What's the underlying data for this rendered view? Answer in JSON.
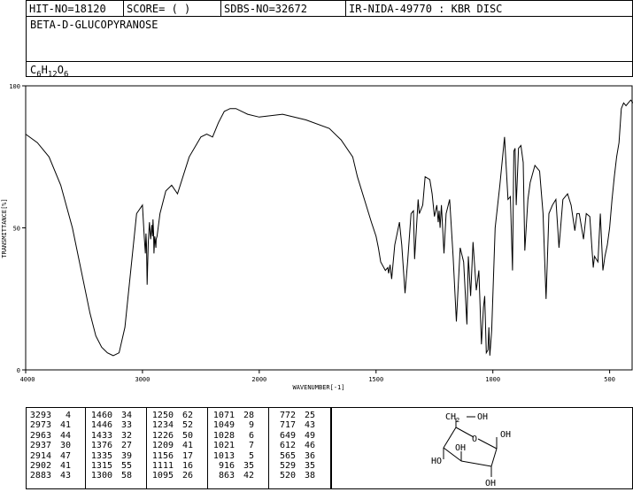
{
  "header": {
    "hit_no": "HIT-NO=18120",
    "score": "SCORE=  (   )",
    "sdbs_no": "SDBS-NO=32672",
    "ir_code": "IR-NIDA-49770 : KBR DISC",
    "compound_name": "BETA-D-GLUCOPYRANOSE",
    "formula": {
      "c": "C",
      "c_n": "6",
      "h": "H",
      "h_n": "12",
      "o": "O",
      "o_n": "6"
    }
  },
  "chart_data": {
    "type": "line",
    "xlabel": "WAVENUMBER[-1]",
    "ylabel": "TRANSMITTANCE[%]",
    "xlim": [
      4000,
      400
    ],
    "ylim": [
      0,
      100
    ],
    "x_ticks": [
      4000,
      3000,
      2000,
      1500,
      1000,
      500
    ],
    "y_ticks": [
      0,
      50,
      100
    ],
    "series": [
      {
        "x": [
          4000,
          3900,
          3800,
          3700,
          3600,
          3500,
          3450,
          3400,
          3350,
          3300,
          3250,
          3200,
          3150,
          3100,
          3050,
          3000,
          2985,
          2975,
          2970,
          2965,
          2960,
          2950,
          2940,
          2937,
          2930,
          2920,
          2914,
          2910,
          2905,
          2902,
          2895,
          2885,
          2883,
          2875,
          2850,
          2800,
          2750,
          2700,
          2600,
          2500,
          2450,
          2400,
          2350,
          2300,
          2250,
          2200,
          2150,
          2100,
          2000,
          1900,
          1800,
          1700,
          1650,
          1600,
          1580,
          1550,
          1520,
          1500,
          1490,
          1480,
          1460,
          1450,
          1446,
          1440,
          1433,
          1420,
          1400,
          1390,
          1376,
          1365,
          1350,
          1340,
          1335,
          1320,
          1315,
          1300,
          1290,
          1270,
          1260,
          1250,
          1240,
          1234,
          1230,
          1226,
          1220,
          1209,
          1200,
          1185,
          1170,
          1156,
          1140,
          1125,
          1111,
          1105,
          1095,
          1085,
          1071,
          1060,
          1049,
          1040,
          1035,
          1028,
          1021,
          1017,
          1013,
          1005,
          990,
          970,
          950,
          935,
          925,
          916,
          910,
          905,
          900,
          890,
          880,
          870,
          863,
          850,
          840,
          820,
          800,
          785,
          772,
          760,
          745,
          730,
          717,
          700,
          680,
          665,
          649,
          640,
          630,
          612,
          600,
          585,
          570,
          565,
          550,
          540,
          529,
          520,
          510,
          500,
          490,
          480,
          470,
          460,
          450,
          440,
          430,
          420,
          410,
          400
        ],
        "y": [
          83,
          80,
          75,
          65,
          50,
          30,
          20,
          12,
          8,
          6,
          5,
          6,
          15,
          35,
          55,
          58,
          47,
          41,
          48,
          44,
          30,
          45,
          52,
          50,
          46,
          51,
          47,
          53,
          48,
          41,
          47,
          43,
          46,
          47,
          55,
          63,
          65,
          62,
          75,
          82,
          83,
          82,
          87,
          91,
          92,
          92,
          91,
          90,
          89,
          90,
          88,
          85,
          81,
          75,
          68,
          60,
          52,
          47,
          43,
          38,
          35,
          36,
          34,
          37,
          32,
          44,
          52,
          44,
          27,
          38,
          55,
          56,
          39,
          60,
          55,
          58,
          68,
          67,
          62,
          54,
          58,
          52,
          56,
          50,
          58,
          41,
          55,
          60,
          40,
          17,
          43,
          38,
          16,
          40,
          26,
          45,
          28,
          35,
          9,
          22,
          26,
          6,
          7,
          15,
          5,
          14,
          50,
          65,
          82,
          60,
          61,
          35,
          77,
          78,
          58,
          78,
          79,
          73,
          42,
          60,
          66,
          72,
          70,
          55,
          25,
          55,
          58,
          60,
          43,
          60,
          62,
          58,
          49,
          55,
          55,
          46,
          55,
          54,
          36,
          40,
          38,
          55,
          35,
          40,
          44,
          50,
          60,
          68,
          75,
          80,
          92,
          94,
          93,
          94,
          95,
          94
        ]
      }
    ]
  },
  "peak_table": {
    "columns": [
      [
        [
          "3293",
          "4"
        ],
        [
          "2973",
          "41"
        ],
        [
          "2963",
          "44"
        ],
        [
          "2937",
          "30"
        ],
        [
          "2914",
          "47"
        ],
        [
          "2902",
          "41"
        ],
        [
          "2883",
          "43"
        ]
      ],
      [
        [
          "1460",
          "34"
        ],
        [
          "1446",
          "33"
        ],
        [
          "1433",
          "32"
        ],
        [
          "1376",
          "27"
        ],
        [
          "1335",
          "39"
        ],
        [
          "1315",
          "55"
        ],
        [
          "1300",
          "58"
        ]
      ],
      [
        [
          "1250",
          "62"
        ],
        [
          "1234",
          "52"
        ],
        [
          "1226",
          "50"
        ],
        [
          "1209",
          "41"
        ],
        [
          "1156",
          "17"
        ],
        [
          "1111",
          "16"
        ],
        [
          "1095",
          "26"
        ]
      ],
      [
        [
          "1071",
          "28"
        ],
        [
          "1049",
          "9"
        ],
        [
          "1028",
          "6"
        ],
        [
          "1021",
          "7"
        ],
        [
          "1013",
          "5"
        ],
        [
          "916",
          "35"
        ],
        [
          "863",
          "42"
        ]
      ],
      [
        [
          "772",
          "25"
        ],
        [
          "717",
          "43"
        ],
        [
          "649",
          "49"
        ],
        [
          "612",
          "46"
        ],
        [
          "565",
          "36"
        ],
        [
          "529",
          "35"
        ],
        [
          "520",
          "38"
        ]
      ]
    ]
  },
  "structure": {
    "labels": {
      "ch2oh_ch2": "CH",
      "ch2oh_sub": "2",
      "ch2oh_oh": "OH",
      "ring_o": "O",
      "oh_c1": "OH",
      "oh_c4": "OH",
      "oh_c3": "HO",
      "oh_c2": "OH"
    }
  }
}
